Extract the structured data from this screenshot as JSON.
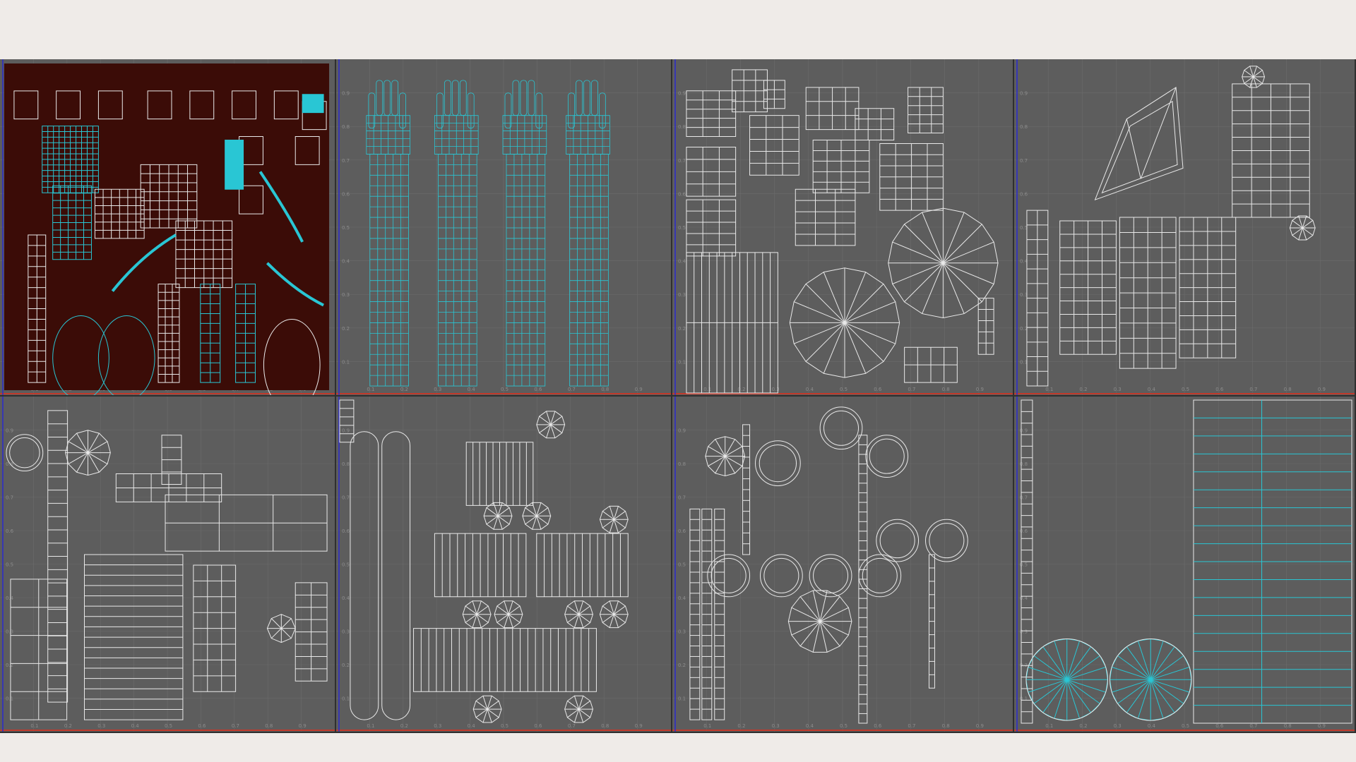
{
  "colors": {
    "background": "#efebe8",
    "viewport": "#5d5d5d",
    "grid_line": "#6c6c6c",
    "wire_white": "#e9e9e9",
    "wire_cyan": "#29c6d4",
    "texture_red": "#3b0c07",
    "axis_u": "#c0392b",
    "axis_v": "#2b2bd0",
    "axis_origin_green": "#2ea043"
  },
  "panels": [
    {
      "id": "uv-panel-1",
      "content": "textured clothing uv islands",
      "icon": "uv-layout-icon"
    },
    {
      "id": "uv-panel-2",
      "content": "hands and arms uv islands",
      "icon": "uv-layout-icon"
    },
    {
      "id": "uv-panel-3",
      "content": "boxes and wheels uv islands",
      "icon": "uv-layout-icon"
    },
    {
      "id": "uv-panel-4",
      "content": "frame and barrels uv islands",
      "icon": "uv-layout-icon"
    },
    {
      "id": "uv-panel-5",
      "content": "machine parts uv islands",
      "icon": "uv-layout-icon"
    },
    {
      "id": "uv-panel-6",
      "content": "tubes and crates uv islands",
      "icon": "uv-layout-icon"
    },
    {
      "id": "uv-panel-7",
      "content": "rings and poles uv islands",
      "icon": "uv-layout-icon"
    },
    {
      "id": "uv-panel-8",
      "content": "wheels and strip uv islands",
      "icon": "uv-layout-icon"
    }
  ],
  "tick_labels": {
    "u": [
      "0.1",
      "0.2",
      "0.3",
      "0.4",
      "0.5",
      "0.6",
      "0.7",
      "0.8",
      "0.9"
    ],
    "v": [
      "0.9",
      "0.8",
      "0.7",
      "0.6",
      "0.5",
      "0.4",
      "0.3",
      "0.2",
      "0.1"
    ]
  }
}
